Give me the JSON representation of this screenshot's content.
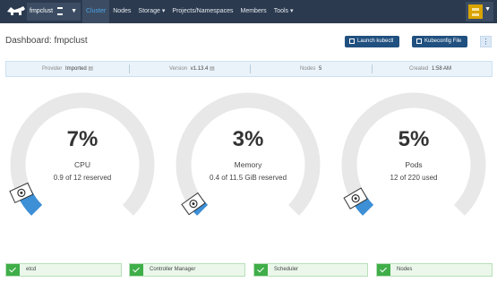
{
  "topbar": {
    "cluster_name": "fmpclust",
    "nav": [
      {
        "label": "Cluster",
        "active": true
      },
      {
        "label": "Nodes",
        "active": false
      },
      {
        "label": "Storage ▾",
        "active": false
      },
      {
        "label": "Projects/Namespaces",
        "active": false
      },
      {
        "label": "Members",
        "active": false
      },
      {
        "label": "Tools ▾",
        "active": false
      }
    ]
  },
  "header": {
    "title": "Dashboard: fmpclust",
    "launch_kubectl": "Launch kubectl",
    "kubeconfig": "Kubeconfig File",
    "more": "⋮"
  },
  "info": {
    "provider_label": "Provider",
    "provider_value": "Imported",
    "version_label": "Version",
    "version_value": "v1.13.4",
    "nodes_label": "Nodes",
    "nodes_value": "5",
    "created_label": "Created",
    "created_value": "1:58 AM"
  },
  "gauges": [
    {
      "pct": "7%",
      "label": "CPU",
      "sub": "0.9 of 12 reserved",
      "used_fraction": 0.07,
      "reserved_fraction": 0.075
    },
    {
      "pct": "3%",
      "label": "Memory",
      "sub": "0.4 of 11.5 GiB reserved",
      "used_fraction": 0.03,
      "reserved_fraction": 0.035
    },
    {
      "pct": "5%",
      "label": "Pods",
      "sub": "12 of 220 used",
      "used_fraction": 0.05,
      "reserved_fraction": 0.055
    }
  ],
  "components": [
    {
      "label": "etcd"
    },
    {
      "label": "Controller Manager"
    },
    {
      "label": "Scheduler"
    },
    {
      "label": "Nodes"
    }
  ],
  "colors": {
    "nav_bg": "#2b3a4f",
    "accent": "#4ca2e8",
    "primary_btn": "#20507f",
    "gauge_track": "#e8e8e8",
    "gauge_fill": "#3d8fd6",
    "healthy": "#3fae49"
  }
}
